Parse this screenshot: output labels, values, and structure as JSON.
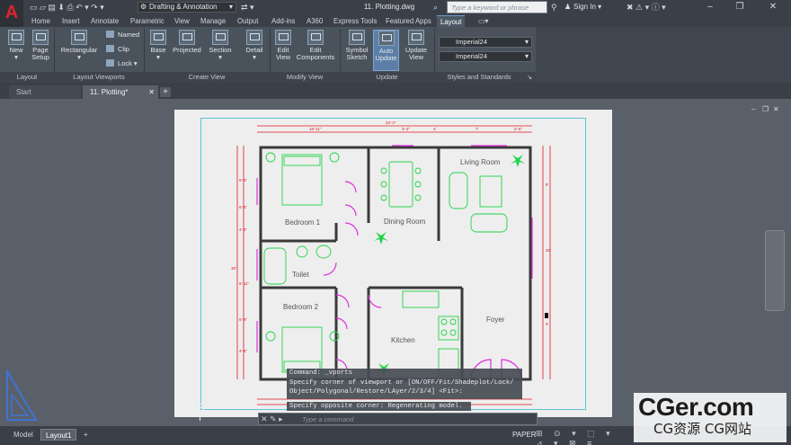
{
  "app": {
    "logo": "A",
    "workspace": "Drafting & Annotation",
    "document_title": "11. Plotting.dwg",
    "search_placeholder": "Type a keyword or phrase",
    "sign_in": "Sign In"
  },
  "menu_tabs": [
    "Home",
    "Insert",
    "Annotate",
    "Parametric",
    "View",
    "Manage",
    "Output",
    "Add-ins",
    "A360",
    "Express Tools",
    "Featured Apps",
    "Layout"
  ],
  "active_tab": "Layout",
  "ribbon": {
    "layout_panel": {
      "label": "Layout",
      "tools": [
        "New",
        "Page Setup"
      ]
    },
    "viewports_panel": {
      "label": "Layout Viewports",
      "rectangular": "Rectangular",
      "named": "Named",
      "clip": "Clip",
      "lock": "Lock"
    },
    "create_view_panel": {
      "label": "Create View",
      "tools": [
        "Base",
        "Projected",
        "Section",
        "Detail"
      ]
    },
    "modify_view_panel": {
      "label": "Modify View",
      "tools": [
        "Edit View",
        "Edit Components"
      ]
    },
    "update_panel": {
      "label": "Update",
      "tools": [
        "Symbol Sketch",
        "Auto Update",
        "Update View"
      ]
    },
    "styles_panel": {
      "label": "Styles and Standards",
      "style1": "Imperial24",
      "style2": "Imperial24"
    }
  },
  "doc_tabs": [
    "Start",
    "11. Plotting*"
  ],
  "plan": {
    "rooms": [
      "Bedroom 1",
      "Dining Room",
      "Living Room",
      "Toilet",
      "Bedroom 2",
      "Kitchen",
      "Foyer"
    ],
    "dims_top": [
      "34'-2\"",
      "16'-11\"",
      "3'-2\"",
      "4'",
      "7'",
      "2'-6\""
    ],
    "dims_left": [
      "30'",
      "6'-6\"",
      "6'-6\"",
      "4'-6\"",
      "6'-11\"",
      "6'-8\"",
      "4'-6\""
    ],
    "dims_right": [
      "30'",
      "8'",
      "6'"
    ]
  },
  "command_history": [
    "Command: _vports",
    "Specify corner of viewport or [ON/OFF/Fit/Shadeplot/Lock/",
    "Object/Polygonal/Restore/LAyer/2/3/4] <Fit>:",
    "Specify opposite corner: Regenerating model."
  ],
  "command_placeholder": "Type a command",
  "command_buttons": "✕ ✎ ▸",
  "status": {
    "layout_tabs": [
      "Model",
      "Layout1"
    ],
    "active_layout": "Layout1",
    "space": "PAPER",
    "icons": "⊞ ⊙ ▾ ⬚ ▾ ⊿ ▾ ⊠ ≡"
  },
  "watermark": {
    "line1": "CGer.com",
    "line2": "CG资源 CG网站"
  },
  "colors": {
    "wall": "#404040",
    "fixture": "#22d34a",
    "door": "#e02ee0",
    "dimension": "#e0161c"
  }
}
